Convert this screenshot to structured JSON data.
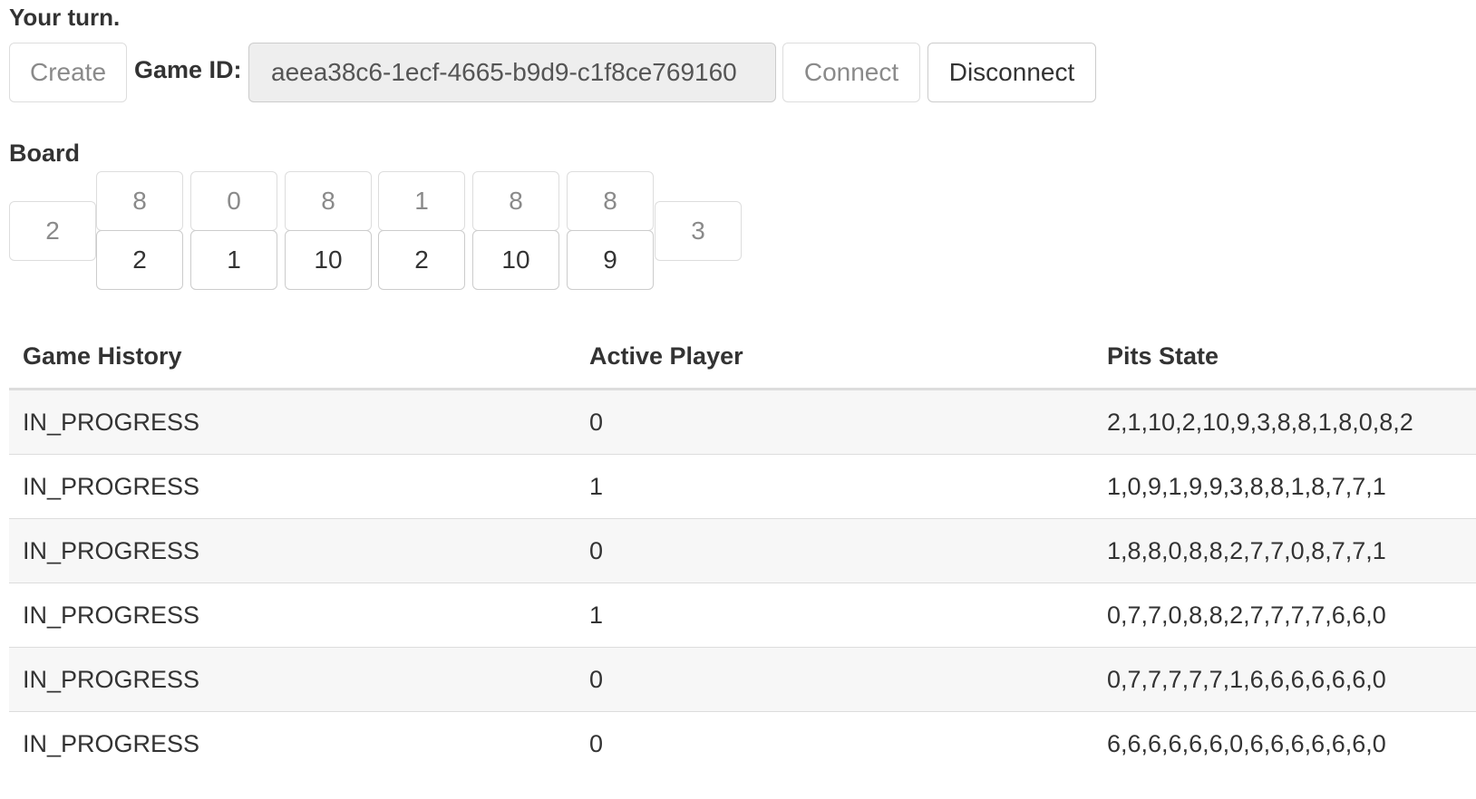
{
  "status": {
    "turn_text": "Your turn."
  },
  "toolbar": {
    "create_label": "Create",
    "game_id_label": "Game ID:",
    "game_id_value": "aeea38c6-1ecf-4665-b9d9-c1f8ce769160",
    "connect_label": "Connect",
    "disconnect_label": "Disconnect"
  },
  "board": {
    "title": "Board",
    "left_store": "2",
    "right_store": "3",
    "top_pits": [
      "8",
      "0",
      "8",
      "1",
      "8",
      "8"
    ],
    "bottom_pits": [
      "2",
      "1",
      "10",
      "2",
      "10",
      "9"
    ]
  },
  "history": {
    "headers": [
      "Game History",
      "Active Player",
      "Pits State"
    ],
    "rows": [
      [
        "IN_PROGRESS",
        "0",
        "2,1,10,2,10,9,3,8,8,1,8,0,8,2"
      ],
      [
        "IN_PROGRESS",
        "1",
        "1,0,9,1,9,9,3,8,8,1,8,7,7,1"
      ],
      [
        "IN_PROGRESS",
        "0",
        "1,8,8,0,8,8,2,7,7,0,8,7,7,1"
      ],
      [
        "IN_PROGRESS",
        "1",
        "0,7,7,0,8,8,2,7,7,7,7,6,6,0"
      ],
      [
        "IN_PROGRESS",
        "0",
        "0,7,7,7,7,7,1,6,6,6,6,6,6,0"
      ],
      [
        "IN_PROGRESS",
        "0",
        "6,6,6,6,6,6,0,6,6,6,6,6,6,0"
      ]
    ]
  }
}
